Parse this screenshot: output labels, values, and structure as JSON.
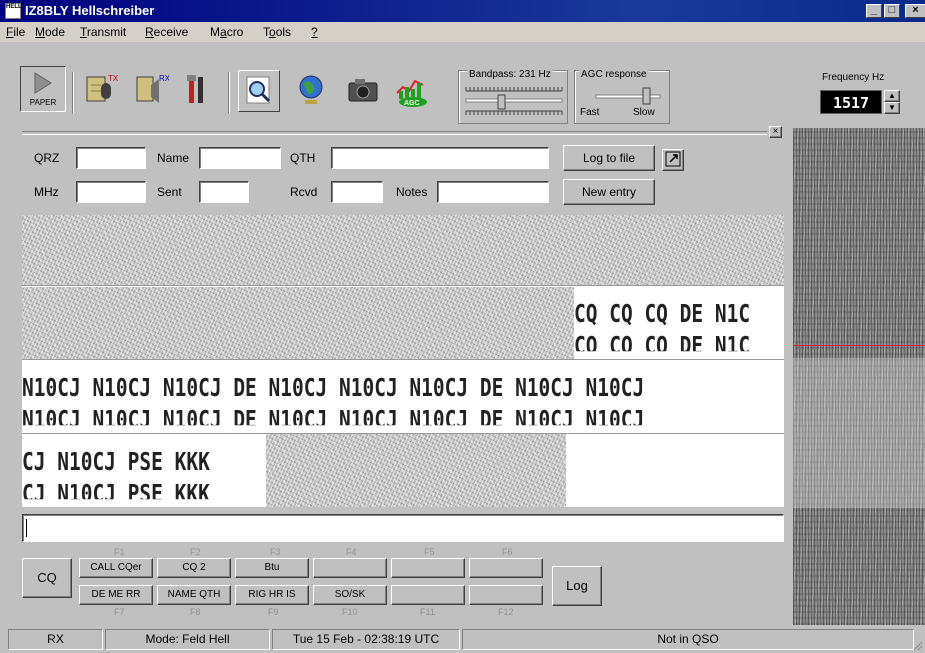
{
  "window": {
    "title": "IZ8BLY Hellschreiber",
    "icon_text": "HELL"
  },
  "menu": [
    {
      "label": "File",
      "ul": "F",
      "rest": "ile"
    },
    {
      "label": "Mode",
      "ul": "M",
      "rest": "ode"
    },
    {
      "label": "Transmit",
      "ul": "T",
      "rest": "ransmit"
    },
    {
      "label": "Receive",
      "ul": "R",
      "rest": "eceive"
    },
    {
      "label": "Macro",
      "ul": "a",
      "pre": "M",
      "rest": "cro"
    },
    {
      "label": "Tools",
      "ul": "o",
      "pre": "T",
      "rest": "ols"
    },
    {
      "label": "?",
      "ul": "?",
      "rest": ""
    }
  ],
  "toolbar": {
    "paper_label": "PAPER",
    "icons": [
      "tx-microphone-icon",
      "rx-speaker-icon",
      "tools-icon",
      "zoom-icon",
      "globe-icon",
      "camera-icon",
      "agc-icon"
    ],
    "agc_icon_text": "AGC",
    "bandpass_label": "Bandpass: 231 Hz",
    "agc_label": "AGC response",
    "agc_fast": "Fast",
    "agc_slow": "Slow",
    "frequency_label": "Frequency Hz",
    "frequency_value": "1517"
  },
  "log_form": {
    "qrz_label": "QRZ",
    "qrz_value": "",
    "name_label": "Name",
    "name_value": "",
    "qth_label": "QTH",
    "qth_value": "",
    "mhz_label": "MHz",
    "mhz_value": "",
    "sent_label": "Sent",
    "sent_value": "",
    "rcvd_label": "Rcvd",
    "rcvd_value": "",
    "notes_label": "Notes",
    "notes_value": "",
    "log_to_file": "Log to file",
    "new_entry": "New entry"
  },
  "rx_text": {
    "row2_right": "CQ CQ CQ DE N1C",
    "row2_right_b": "CQ CQ CQ DE N1C",
    "row3": "N10CJ N10CJ N10CJ DE N10CJ N10CJ N10CJ DE N10CJ N10CJ",
    "row3b": "N10CJ N10CJ N10CJ DE N10CJ N10CJ N10CJ DE N10CJ N10CJ",
    "row4": "CJ N10CJ PSE KKK",
    "row4b": "CJ N10CJ PSE KKK"
  },
  "tx_input_value": "",
  "macros": {
    "cq": "CQ",
    "log": "Log",
    "top_keys": [
      "F1",
      "F2",
      "F3",
      "F4",
      "F5",
      "F6"
    ],
    "bottom_keys": [
      "F7",
      "F8",
      "F9",
      "F10",
      "F11",
      "F12"
    ],
    "top": [
      "CALL CQer",
      "CQ 2",
      "Btu",
      "",
      "",
      ""
    ],
    "bottom": [
      "DE ME RR",
      "NAME QTH",
      "RIG HR IS",
      "SO/SK",
      "",
      ""
    ]
  },
  "status": {
    "rx": "RX",
    "mode": "Mode: Feld Hell",
    "datetime": "Tue 15 Feb - 02:38:19 UTC",
    "qso": "Not in QSO"
  },
  "colors": {
    "title_bar": "#000080",
    "marker_line": "#e02020",
    "background": "#c0c0c0"
  }
}
